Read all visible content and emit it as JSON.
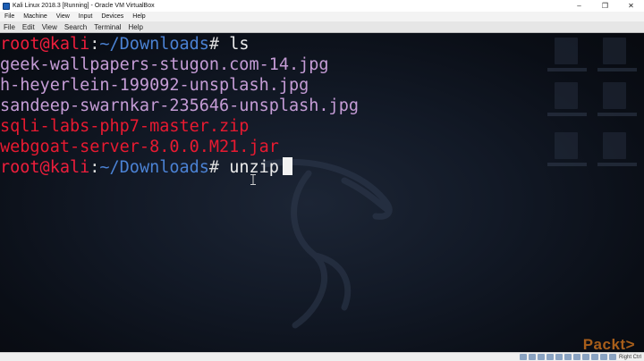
{
  "vbox": {
    "title": "Kali Linux 2018.3 [Running] - Oracle VM VirtualBox",
    "menu": [
      "File",
      "Machine",
      "View",
      "Input",
      "Devices",
      "Help"
    ],
    "status_host_key": "Right Ctrl"
  },
  "terminal": {
    "menu": [
      "File",
      "Edit",
      "View",
      "Search",
      "Terminal",
      "Help"
    ],
    "prompt_user": "root@kali",
    "prompt_colon": ":",
    "prompt_path": "~/Downloads",
    "prompt_symbol": "#",
    "commands": [
      "ls",
      "unzip"
    ],
    "files": [
      "geek-wallpapers-stugon.com-14.jpg",
      "h-heyerlein-199092-unsplash.jpg",
      "sandeep-swarnkar-235646-unsplash.jpg",
      "sqli-labs-php7-master.zip",
      "webgoat-server-8.0.0.M21.jar"
    ]
  },
  "watermark": "Packt>",
  "colors": {
    "prompt_user": "#ef1e3c",
    "prompt_path": "#4b82d4",
    "image_files": "#c59cd6",
    "archive_files": "#e81a31"
  }
}
